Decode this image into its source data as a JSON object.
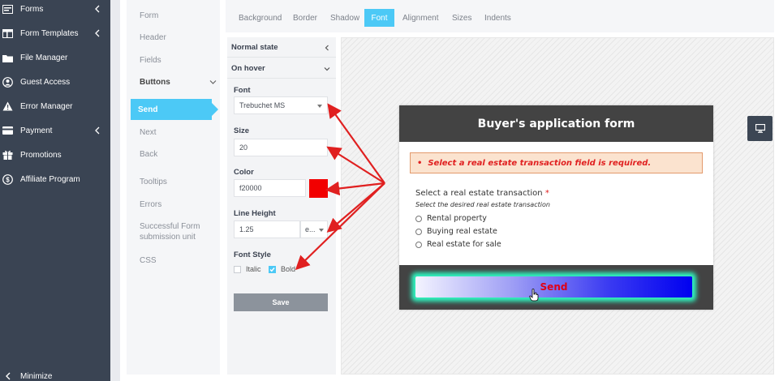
{
  "sidebar": {
    "items": [
      {
        "label": "Forms",
        "icon": "forms-icon",
        "has_submenu": true
      },
      {
        "label": "Form Templates",
        "icon": "templates-icon",
        "has_submenu": true
      },
      {
        "label": "File Manager",
        "icon": "folder-icon",
        "has_submenu": false
      },
      {
        "label": "Guest Access",
        "icon": "user-circle-icon",
        "has_submenu": false
      },
      {
        "label": "Error Manager",
        "icon": "warning-icon",
        "has_submenu": false
      },
      {
        "label": "Payment",
        "icon": "card-icon",
        "has_submenu": true
      },
      {
        "label": "Promotions",
        "icon": "gift-icon",
        "has_submenu": false
      },
      {
        "label": "Affiliate Program",
        "icon": "dollar-circle-icon",
        "has_submenu": false
      }
    ],
    "minimize_label": "Minimize"
  },
  "subnav": {
    "form": "Form",
    "header": "Header",
    "fields": "Fields",
    "buttons": "Buttons",
    "send": "Send",
    "next": "Next",
    "back": "Back",
    "tooltips": "Tooltips",
    "errors": "Errors",
    "success_line1": "Successful Form",
    "success_line2": "submission unit",
    "css": "CSS"
  },
  "tabs": [
    "Background",
    "Border",
    "Shadow",
    "Font",
    "Alignment",
    "Sizes",
    "Indents"
  ],
  "active_tab": "Font",
  "panel": {
    "normal_state": "Normal state",
    "on_hover": "On hover",
    "font_label": "Font",
    "font_value": "Trebuchet MS",
    "size_label": "Size",
    "size_value": "20",
    "color_label": "Color",
    "color_value": "f20000",
    "color_swatch": "#f20000",
    "line_height_label": "Line Height",
    "line_height_value": "1.25",
    "line_height_unit": "e...",
    "font_style_label": "Font Style",
    "italic_label": "Italic",
    "italic_checked": false,
    "bold_label": "Bold",
    "bold_checked": true,
    "save_label": "Save"
  },
  "preview": {
    "form_title": "Buyer's application form",
    "error_message": "Select a real estate transaction field is required.",
    "question_label": "Select a real estate transaction",
    "required_mark": "*",
    "question_help": "Select the desired real estate transaction",
    "options": [
      "Rental property",
      "Buying real estate",
      "Real estate for sale"
    ],
    "send_label": "Send"
  },
  "colors": {
    "accent": "#4cc9f6",
    "sidebar_bg": "#3a4453",
    "annotation_arrow": "#e02020",
    "button_glow": "#2ff5c0"
  }
}
